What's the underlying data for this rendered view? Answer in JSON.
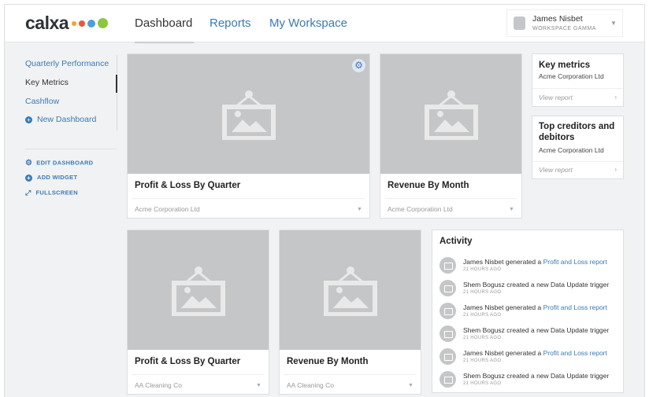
{
  "brand": {
    "name": "calxa",
    "dots": [
      "#f6a12b",
      "#e9573f",
      "#4a9fe0",
      "#8cc63f"
    ]
  },
  "nav": {
    "tabs": [
      {
        "label": "Dashboard"
      },
      {
        "label": "Reports"
      },
      {
        "label": "My Workspace"
      }
    ]
  },
  "user": {
    "name": "James Nisbet",
    "workspace": "WORKSPACE GAMMA"
  },
  "sidebar": {
    "items": [
      {
        "label": "Quarterly Performance"
      },
      {
        "label": "Key Metrics"
      },
      {
        "label": "Cashflow"
      },
      {
        "label": "New Dashboard"
      }
    ],
    "actions": [
      {
        "label": "EDIT DASHBOARD"
      },
      {
        "label": "ADD WIDGET"
      },
      {
        "label": "FULLSCREEN"
      }
    ]
  },
  "widgets": [
    {
      "title": "Profit & Loss By Quarter",
      "company": "Acme Corporation Ltd"
    },
    {
      "title": "Revenue By Month",
      "company": "Acme Corporation Ltd"
    },
    {
      "title": "Profit & Loss By Quarter",
      "company": "AA Cleaning Co"
    },
    {
      "title": "Revenue By Month",
      "company": "AA Cleaning Co"
    }
  ],
  "report_cards": [
    {
      "title": "Key metrics",
      "company": "Acme Corporation Ltd",
      "link": "View report"
    },
    {
      "title": "Top creditors and debitors",
      "company": "Acme Corporation Ltd",
      "link": "View report"
    }
  ],
  "activity": {
    "title": "Activity",
    "items": [
      {
        "text": "James Nisbet generated a ",
        "link": "Profit and Loss report",
        "time": "21 HOURS AGO"
      },
      {
        "text": "Shem Bogusz created a new Data Update trigger",
        "link": "",
        "time": "21 HOURS AGO"
      },
      {
        "text": "James Nisbet generated a ",
        "link": "Profit and Loss report",
        "time": "21 HOURS AGO"
      },
      {
        "text": "Shem Bogusz created a new Data Update trigger",
        "link": "",
        "time": "21 HOURS AGO"
      },
      {
        "text": "James Nisbet generated a ",
        "link": "Profit and Loss report",
        "time": "21 HOURS AGO"
      },
      {
        "text": "Shem Bogusz created a new Data Update trigger",
        "link": "",
        "time": "21 HOURS AGO"
      }
    ]
  }
}
